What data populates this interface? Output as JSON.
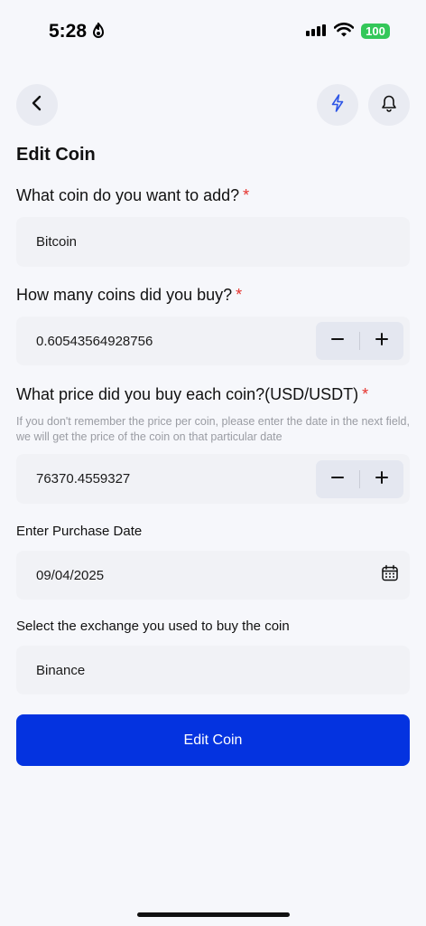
{
  "status_bar": {
    "time": "5:28",
    "battery": "100"
  },
  "header": {
    "back_icon": "chevron-left-icon",
    "flash_icon": "lightning-icon",
    "notification_icon": "bell-icon"
  },
  "page": {
    "title": "Edit Coin"
  },
  "coin": {
    "label": "What coin do you want to add?",
    "required": "*",
    "value": "Bitcoin"
  },
  "quantity": {
    "label": "How many coins did you buy?",
    "required": "*",
    "value": "0.60543564928756"
  },
  "price": {
    "label": "What price did you buy each coin?(USD/USDT)",
    "required": "*",
    "helper": "If you don't remember the price per coin, please enter the date in the next field, we will get the price of the coin on that particular date",
    "value": "76370.4559327"
  },
  "date": {
    "label": "Enter Purchase Date",
    "value": "09/04/2025",
    "icon": "calendar-icon"
  },
  "exchange": {
    "label": "Select the exchange you used to buy the coin",
    "value": "Binance"
  },
  "submit": {
    "label": "Edit Coin"
  },
  "colors": {
    "primary": "#0433e0",
    "required": "#e5322d",
    "battery": "#34c759",
    "background": "#f6f7fb"
  }
}
